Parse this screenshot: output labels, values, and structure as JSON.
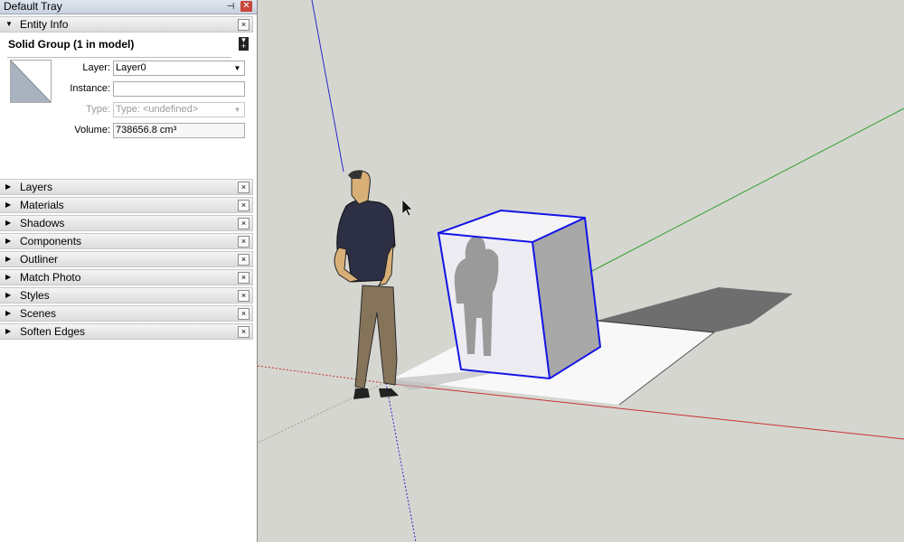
{
  "tray": {
    "title": "Default Tray",
    "pin_glyph": "⊣",
    "close_glyph": "✕"
  },
  "entity_info": {
    "header": "Entity Info",
    "selection_title": "Solid Group (1 in model)",
    "fields": {
      "layer": {
        "label": "Layer:",
        "value": "Layer0"
      },
      "instance": {
        "label": "Instance:",
        "value": ""
      },
      "type": {
        "label": "Type:",
        "value": "Type: <undefined>"
      },
      "volume": {
        "label": "Volume:",
        "value": "738656.8 cm³"
      }
    }
  },
  "panels": [
    {
      "label": "Layers"
    },
    {
      "label": "Materials"
    },
    {
      "label": "Shadows"
    },
    {
      "label": "Components"
    },
    {
      "label": "Outliner"
    },
    {
      "label": "Match Photo"
    },
    {
      "label": "Styles"
    },
    {
      "label": "Scenes"
    },
    {
      "label": "Soften Edges"
    }
  ],
  "icons": {
    "collapsed": "▶",
    "expanded": "▼",
    "close": "×",
    "dropdown": "▼"
  },
  "colors": {
    "viewport_bg": "#d6d6d1",
    "red_axis": "#c83232",
    "green_axis": "#2fa02f",
    "blue_axis": "#2828c8",
    "selection": "#1414e6"
  }
}
